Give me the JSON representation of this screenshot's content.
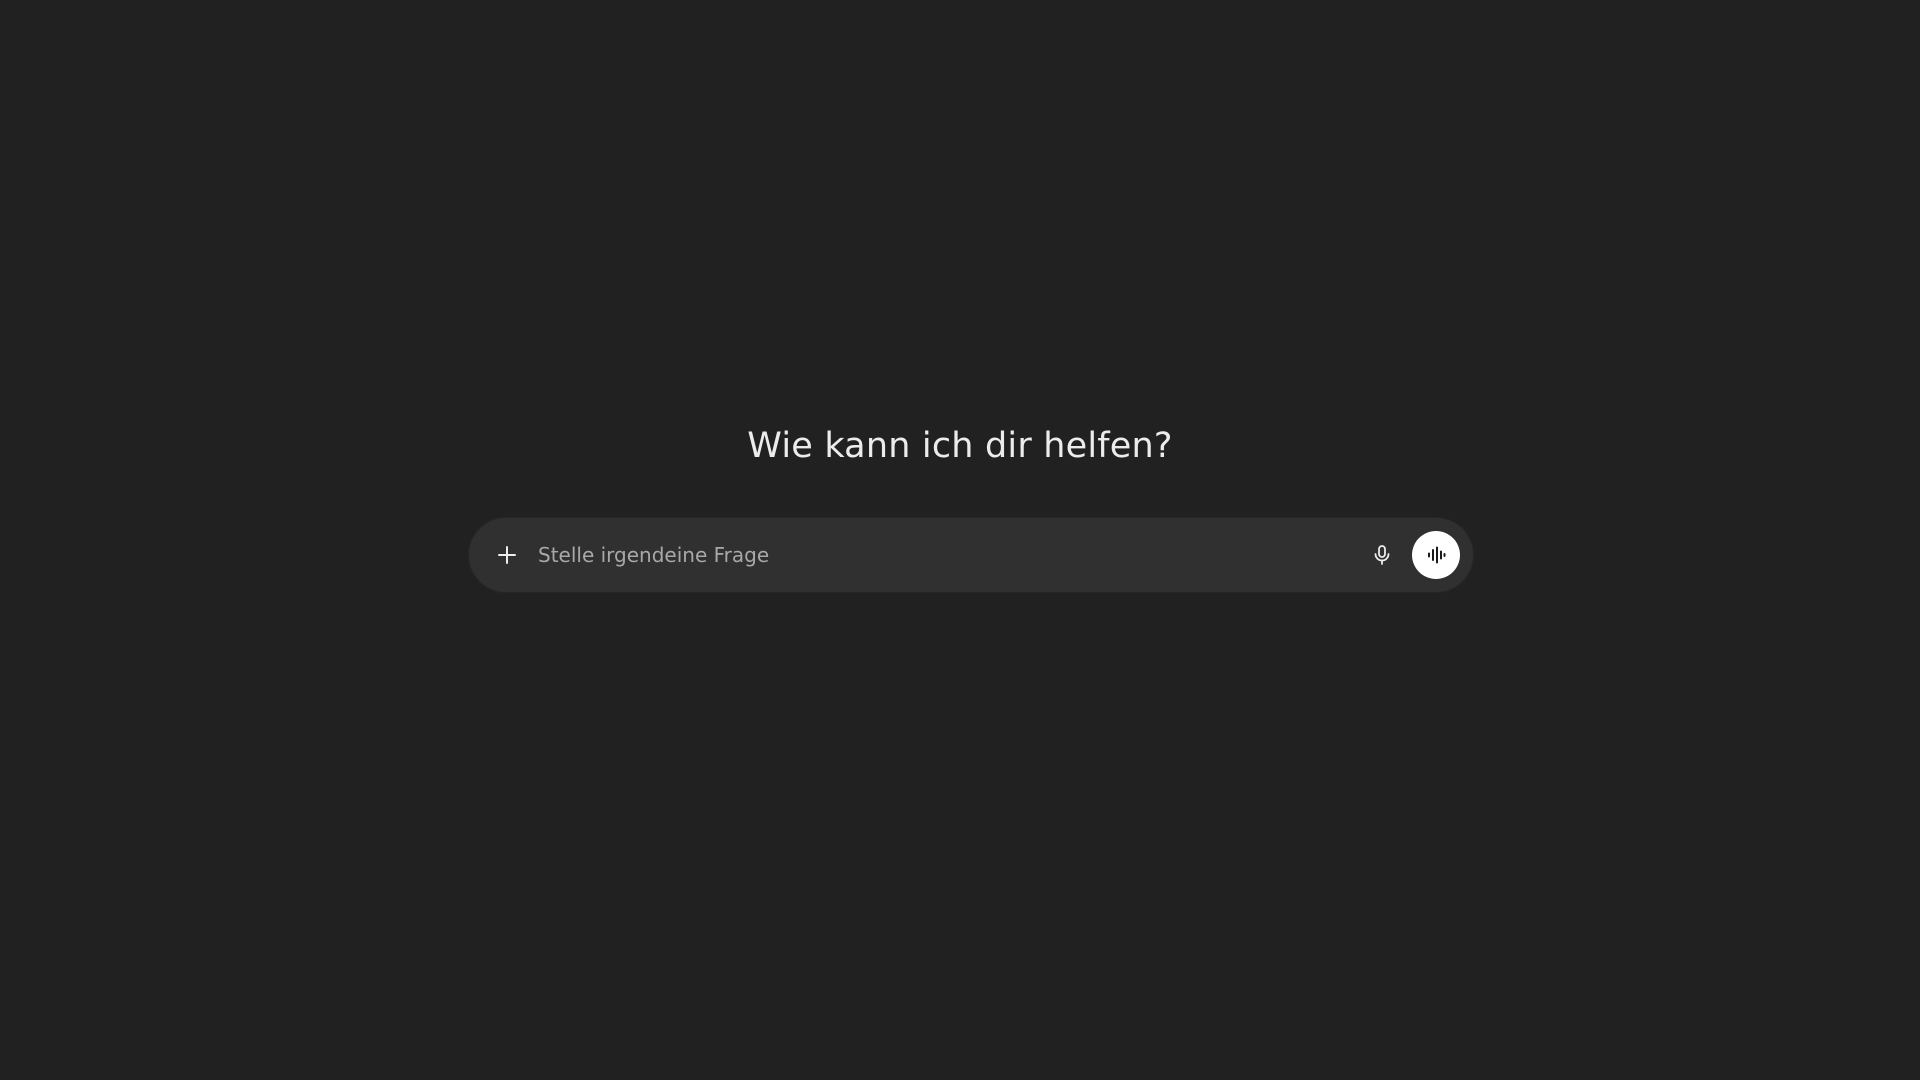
{
  "main": {
    "heading": "Wie kann ich dir helfen?"
  },
  "composer": {
    "placeholder": "Stelle irgendeine Frage",
    "value": "",
    "icons": {
      "add": "plus-icon",
      "dictate": "microphone-icon",
      "voice_mode": "voice-waveform-icon"
    }
  },
  "colors": {
    "background": "#212121",
    "composer": "#303030",
    "text": "#ececec",
    "placeholder": "#a8a8a8",
    "voice_button": "#ffffff"
  }
}
